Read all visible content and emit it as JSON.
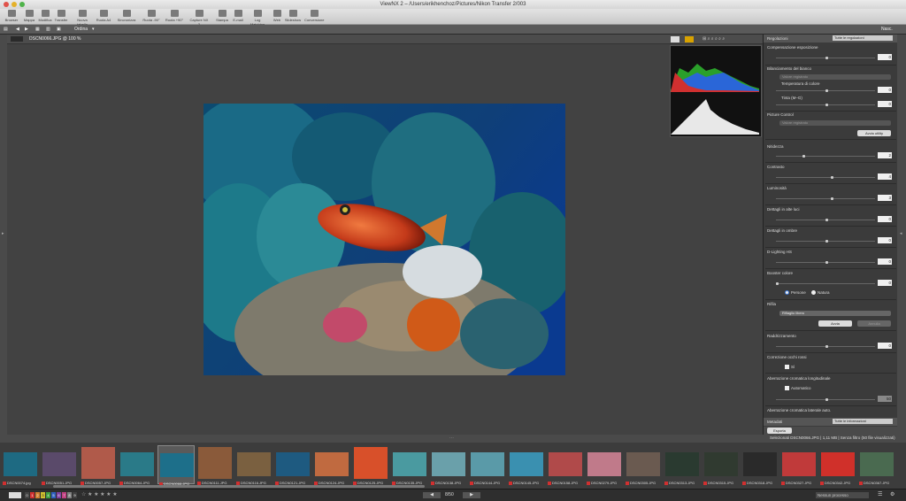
{
  "window": {
    "title": "ViewNX 2 – /Users/erikhenchoz/Pictures/Nikon Transfer 2/003"
  },
  "toolbar": {
    "items": [
      "Browser",
      "Mappa",
      "Modifica",
      "Transfer",
      "Nuova tabella",
      "Ruota A4",
      "Sincronizza",
      "Ruota -90°",
      "Ruota +90°",
      "Capture NX 2",
      "Stampa",
      "E-mail",
      "Log Matching",
      "Web",
      "Slideshow",
      "Conversione"
    ]
  },
  "toolbar2": {
    "sort_label": "Ordina",
    "panel_toggle": "Nasc."
  },
  "viewer": {
    "filename": "DSCN0066.JPG @ 100 %"
  },
  "panel": {
    "header": "Regolazioni",
    "header_dropdown": "Tutte le regolazioni",
    "exposure": {
      "label": "Compensazione esposizione",
      "value": "0"
    },
    "wb": {
      "label": "Bilanciamento del bianco",
      "preset": "Valore registrato",
      "temp_label": "Temperatura di colore",
      "temp_value": "0",
      "tint_label": "Tinta (M–G)",
      "tint_value": "0"
    },
    "picture_control": {
      "label": "Picture Control",
      "preset": "Valore registrato",
      "button": "Avvia utility"
    },
    "sharpness": {
      "label": "Nitidezza",
      "value": "2"
    },
    "contrast": {
      "label": "Contrasto",
      "value": "4"
    },
    "brightness": {
      "label": "Luminosità",
      "value": "3"
    },
    "highlights": {
      "label": "Dettagli in alte luci",
      "value": "0"
    },
    "shadows": {
      "label": "Dettagli in ombre",
      "value": "0"
    },
    "dlighting": {
      "label": "D-Lighting HS",
      "value": "0"
    },
    "color_booster": {
      "label": "Booster colore",
      "value": "0",
      "opt1": "Persone",
      "opt2": "Natura"
    },
    "crop": {
      "label": "Rifila",
      "preset": "Rifiaglio libero",
      "apply": "Avvia",
      "cancel": "Annulla"
    },
    "straighten": {
      "label": "Raddrizzamento",
      "value": "0"
    },
    "red_eye": {
      "label": "Correzione occhi rossi",
      "check": "Sì"
    },
    "axial_ca": {
      "label": "Aberrazione cromatica longitudinale",
      "check": "Automatico",
      "value": "50"
    },
    "lateral_ca": {
      "label": "Aberrazione cromatica laterale auto."
    },
    "metadata": {
      "label": "Metadati",
      "dropdown": "Tutte le informazioni"
    },
    "export": "Esporta"
  },
  "filmstrip": {
    "info": "Selezionati DSCN0066.JPG | 1,11 MB | Senza filtro (50 file visualizzati)",
    "thumbs": [
      "DSCN0074.jpg",
      "DSCN0051.JPG",
      "DSCN0057.JPG",
      "DSCN0064.JPG",
      "DSCN0066.JPG",
      "DSCN0111.JPG",
      "DSCN0116.JPG",
      "DSCN0121.JPG",
      "DSCN0124.JPG",
      "DSCN0125.JPG",
      "DSCN0135.JPG",
      "DSCN0138.JPG",
      "DSCN0144.JPG",
      "DSCN0145.JPG",
      "DSCN0158.JPG",
      "DSCN0279.JPG",
      "DSCN0305.JPG",
      "DSCN0313.JPG",
      "DSCN0315.JPG",
      "DSCN0318.JPG",
      "DSCN0327.JPG",
      "DSCN0342.JPG",
      "DSCN0367.JPG"
    ]
  },
  "status": {
    "page": "8/50",
    "labels": [
      "0",
      "1",
      "2",
      "3",
      "4",
      "5",
      "6",
      "7",
      "8",
      "9"
    ],
    "preview_label": "Nessun processo"
  }
}
